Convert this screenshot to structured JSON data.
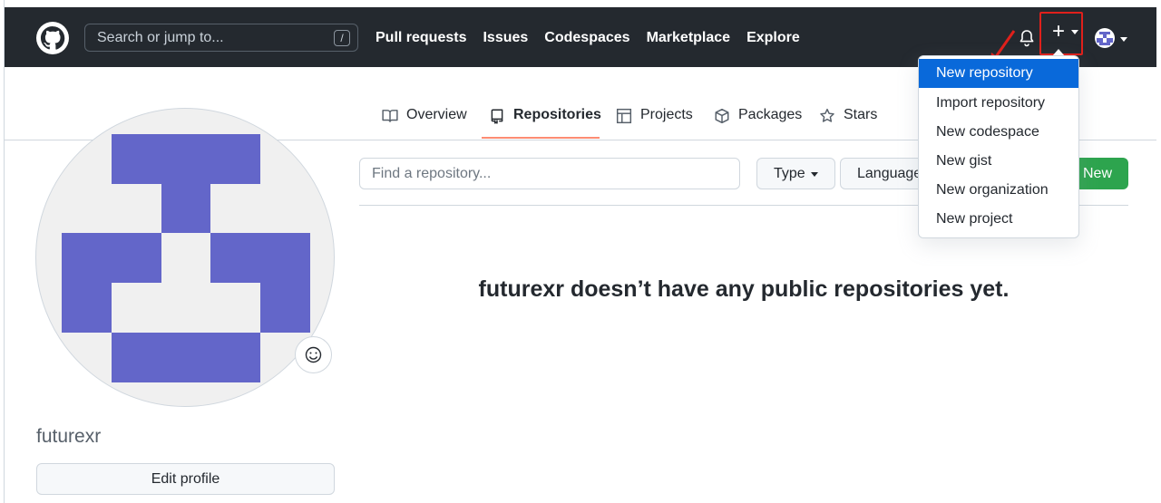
{
  "header": {
    "search_placeholder": "Search or jump to...",
    "search_shortcut": "/",
    "nav": [
      "Pull requests",
      "Issues",
      "Codespaces",
      "Marketplace",
      "Explore"
    ],
    "create_symbol": "+"
  },
  "create_menu": {
    "items": [
      "New repository",
      "Import repository",
      "New codespace",
      "New gist",
      "New organization",
      "New project"
    ],
    "highlighted_index": 0
  },
  "tabs": [
    {
      "label": "Overview",
      "icon": "book-icon"
    },
    {
      "label": "Repositories",
      "icon": "repo-icon",
      "selected": true
    },
    {
      "label": "Projects",
      "icon": "table-icon"
    },
    {
      "label": "Packages",
      "icon": "package-icon"
    },
    {
      "label": "Stars",
      "icon": "star-icon"
    }
  ],
  "profile": {
    "username": "futurexr",
    "edit_label": "Edit profile",
    "identicon_color": "#6366c9"
  },
  "repos": {
    "find_placeholder": "Find a repository...",
    "type_label": "Type",
    "language_label": "Language",
    "new_label": "New",
    "empty_message": "futurexr doesn’t have any public repositories yet."
  },
  "colors": {
    "header_bg": "#24292f",
    "accent_blue": "#0969da",
    "new_green": "#2da44e",
    "annotation_red": "#e0201b",
    "tab_underline": "#fd8c73"
  }
}
